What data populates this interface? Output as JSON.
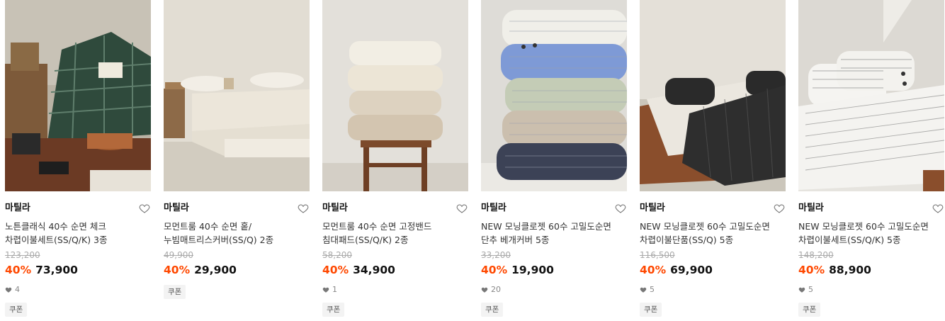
{
  "colors": {
    "discount": "#ff4800",
    "price": "#111111",
    "original_price": "#aaaaaa"
  },
  "products": [
    {
      "image_scene": "plaid-bedding-room",
      "brand": "마틸라",
      "name": "노튼클래식 40수 순면 체크\n차렵이불세트(SS/Q/K) 3종",
      "original_price": "123,200",
      "discount": "40%",
      "price": "73,900",
      "likes": "4",
      "coupon": "쿠폰"
    },
    {
      "image_scene": "mattress-cover-bed",
      "brand": "마틸라",
      "name": "모먼트룸 40수 순면 홑/\n누빔매트리스커버(SS/Q) 2종",
      "original_price": "49,900",
      "discount": "40%",
      "price": "29,900",
      "likes": "",
      "coupon": "쿠폰"
    },
    {
      "image_scene": "folded-pads-stool",
      "brand": "마틸라",
      "name": "모먼트룸 40수 순면 고정밴드\n침대패드(SS/Q/K) 2종",
      "original_price": "58,200",
      "discount": "40%",
      "price": "34,900",
      "likes": "1",
      "coupon": "쿠폰"
    },
    {
      "image_scene": "stacked-pillows",
      "brand": "마틸라",
      "name": "NEW 모닝클로젯 60수 고밀도순면\n단추 베개커버 5종",
      "original_price": "33,200",
      "discount": "40%",
      "price": "19,900",
      "likes": "20",
      "coupon": "쿠폰"
    },
    {
      "image_scene": "black-stripe-bed",
      "brand": "마틸라",
      "name": "NEW 모닝클로젯 60수 고밀도순면\n차렵이불단품(SS/Q) 5종",
      "original_price": "116,500",
      "discount": "40%",
      "price": "69,900",
      "likes": "5",
      "coupon": "쿠폰"
    },
    {
      "image_scene": "white-stripe-bed",
      "brand": "마틸라",
      "name": "NEW 모닝클로젯 60수 고밀도순면\n차렵이불세트(SS/Q/K) 5종",
      "original_price": "148,200",
      "discount": "40%",
      "price": "88,900",
      "likes": "5",
      "coupon": "쿠폰"
    }
  ]
}
